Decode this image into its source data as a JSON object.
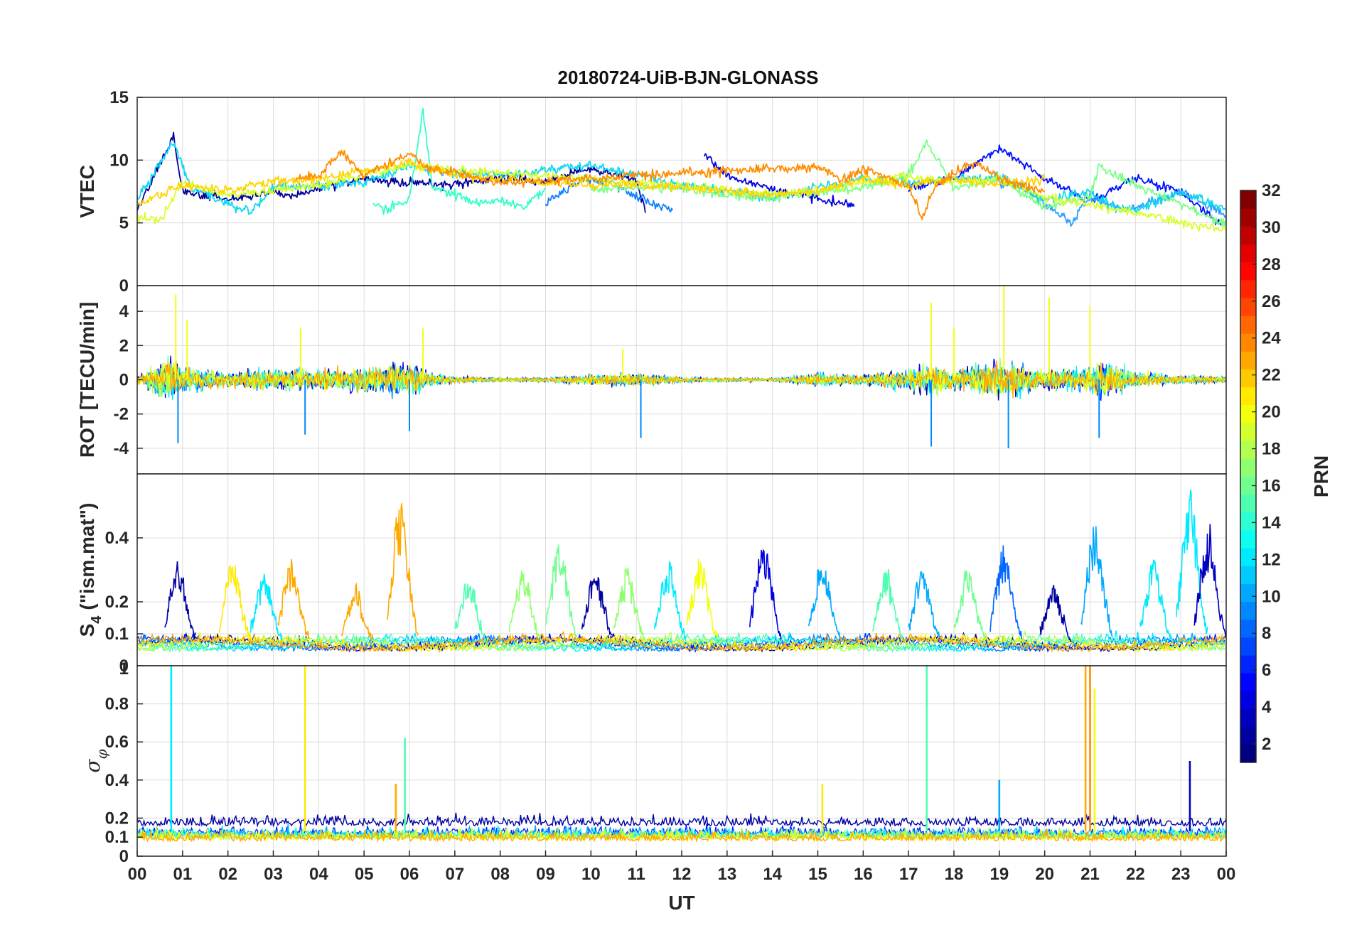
{
  "chart_data": {
    "type": "line",
    "title": "20180724-UiB-BJN-GLONASS",
    "xlabel": "UT",
    "xlim": [
      0,
      24
    ],
    "x_ticks": [
      "00",
      "01",
      "02",
      "03",
      "04",
      "05",
      "06",
      "07",
      "08",
      "09",
      "10",
      "11",
      "12",
      "13",
      "14",
      "15",
      "16",
      "17",
      "18",
      "19",
      "20",
      "21",
      "22",
      "23",
      "00"
    ],
    "grid": true,
    "colorbar": {
      "label": "PRN",
      "range": [
        1,
        32
      ],
      "ticks": [
        "2",
        "4",
        "6",
        "8",
        "10",
        "12",
        "14",
        "16",
        "18",
        "20",
        "22",
        "24",
        "26",
        "28",
        "30",
        "32"
      ],
      "colormap": "jet",
      "placement": "right"
    },
    "panels": [
      {
        "ylabel": "VTEC",
        "ylim": [
          0,
          15
        ],
        "y_ticks": [
          "0",
          "5",
          "10",
          "15"
        ],
        "series": [
          {
            "prn": 2,
            "color": "#00009f",
            "x": [
              0.0,
              0.8,
              1.0,
              2.0,
              3.0,
              3.5,
              4.0,
              5.0,
              6.0,
              7.0,
              8.0,
              9.0,
              10.0,
              11.0,
              11.2
            ],
            "y": [
              6.0,
              12.0,
              7.5,
              6.8,
              7.5,
              7.0,
              7.8,
              8.5,
              8.2,
              8.0,
              8.6,
              8.2,
              9.4,
              8.4,
              5.8
            ]
          },
          {
            "prn": 4,
            "color": "#0000e0",
            "x": [
              12.5,
              13.0,
              14.0,
              15.0,
              15.8
            ],
            "y": [
              10.3,
              8.8,
              7.6,
              7.0,
              6.3
            ]
          },
          {
            "prn": 3,
            "color": "#0010ff",
            "x": [
              17.0,
              18.0,
              19.0,
              20.0,
              21.0,
              22.0,
              23.0,
              23.9
            ],
            "y": [
              7.8,
              8.5,
              11.0,
              8.5,
              6.8,
              8.5,
              7.5,
              4.8
            ]
          },
          {
            "prn": 9,
            "color": "#1080ff",
            "x": [
              9.0,
              9.8,
              10.5,
              11.0,
              11.8
            ],
            "y": [
              6.5,
              8.5,
              8.2,
              7.0,
              6.0
            ]
          },
          {
            "prn": 10,
            "color": "#2a9fff",
            "x": [
              19.0,
              19.5,
              20.0,
              20.6,
              21.0,
              21.8,
              22.5,
              23.0,
              24.0
            ],
            "y": [
              8.0,
              8.0,
              6.5,
              5.0,
              7.0,
              6.0,
              6.8,
              7.5,
              5.6
            ]
          },
          {
            "prn": 12,
            "color": "#10d8f0",
            "x": [
              0.0,
              0.8,
              1.2,
              2.0,
              2.5,
              3.0,
              4.0,
              5.0,
              6.0,
              7.0,
              8.0,
              9.0,
              10.0,
              11.0,
              12.0,
              13.0,
              14.0,
              15.0,
              16.0,
              17.0,
              18.0,
              19.0,
              20.0,
              21.0,
              21.5,
              22.0,
              23.0,
              24.0
            ],
            "y": [
              6.8,
              11.5,
              7.8,
              6.5,
              5.8,
              7.8,
              8.0,
              8.2,
              9.5,
              9.0,
              8.8,
              9.2,
              9.6,
              8.8,
              8.0,
              7.5,
              7.0,
              7.8,
              8.5,
              8.2,
              8.5,
              8.6,
              6.8,
              7.5,
              6.2,
              6.0,
              7.5,
              6.0
            ]
          },
          {
            "prn": 15,
            "color": "#30ffc8",
            "x": [
              5.2,
              5.5,
              6.0,
              6.3,
              6.5,
              7.0,
              7.5,
              8.0,
              8.5,
              9.0
            ],
            "y": [
              6.5,
              6.0,
              7.0,
              14.0,
              8.0,
              7.2,
              6.5,
              6.8,
              6.2,
              7.8
            ]
          },
          {
            "prn": 17,
            "color": "#7aff85",
            "x": [
              10.0,
              11.0,
              12.0,
              13.0,
              14.0,
              15.0,
              16.0,
              17.0,
              17.4,
              18.0,
              19.0,
              20.0,
              21.0,
              21.2,
              22.0,
              23.0,
              24.0
            ],
            "y": [
              7.6,
              7.8,
              7.8,
              7.2,
              7.0,
              7.5,
              7.8,
              8.8,
              11.5,
              7.8,
              8.5,
              6.2,
              7.0,
              9.5,
              8.0,
              6.5,
              4.8
            ]
          },
          {
            "prn": 19,
            "color": "#d8ff28",
            "x": [
              0.0,
              0.5,
              1.0,
              2.0,
              3.0,
              4.0,
              5.0,
              6.0,
              7.0,
              8.0,
              9.0,
              10.0,
              11.0,
              12.0,
              13.0,
              14.0,
              15.0,
              16.0,
              17.0,
              18.0,
              19.0,
              20.0,
              21.0,
              22.0,
              23.0,
              24.0
            ],
            "y": [
              5.5,
              5.2,
              8.2,
              7.2,
              7.5,
              8.0,
              8.8,
              9.6,
              9.2,
              9.0,
              8.8,
              8.5,
              8.2,
              8.0,
              7.5,
              7.3,
              7.6,
              8.2,
              8.8,
              8.2,
              8.5,
              7.0,
              6.5,
              5.8,
              5.0,
              4.5
            ]
          },
          {
            "prn": 21,
            "color": "#ffd400",
            "x": [
              0.0,
              1.0,
              2.0,
              3.0,
              4.0,
              5.0,
              6.0,
              7.0,
              8.0,
              9.0,
              10.0,
              11.0,
              12.0,
              13.0,
              14.0,
              15.0,
              16.0,
              17.0,
              18.0,
              19.0,
              20.0
            ],
            "y": [
              6.5,
              8.0,
              7.5,
              8.3,
              8.5,
              9.2,
              9.8,
              8.8,
              8.5,
              8.2,
              8.0,
              8.0,
              7.8,
              7.6,
              7.2,
              7.5,
              8.5,
              8.0,
              8.5,
              8.0,
              8.5
            ]
          },
          {
            "prn": 23,
            "color": "#ff8c00",
            "x": [
              3.5,
              4.0,
              4.5,
              5.0,
              5.5,
              6.0,
              6.5,
              7.0,
              7.5,
              8.0,
              15.0,
              15.5,
              16.0,
              17.0,
              17.3,
              17.6,
              18.0,
              18.5,
              19.0,
              19.5,
              20.0
            ],
            "y": [
              8.5,
              8.8,
              10.6,
              8.8,
              9.6,
              10.5,
              9.2,
              9.0,
              8.5,
              8.2,
              9.5,
              8.5,
              9.2,
              8.0,
              5.5,
              8.0,
              9.0,
              9.8,
              8.5,
              8.0,
              7.5
            ]
          }
        ]
      },
      {
        "ylabel": "ROT [TECU/min]",
        "ylim": [
          -5.5,
          5.5
        ],
        "y_ticks": [
          "-4",
          "-2",
          "0",
          "2",
          "4"
        ],
        "noise_profile": {
          "hours": [
            0,
            0.8,
            1,
            2,
            3,
            4,
            5,
            6,
            6.5,
            7,
            8,
            9,
            10,
            11,
            12,
            13,
            14,
            15,
            16,
            17,
            17.5,
            18,
            19,
            20,
            21,
            21.2,
            22,
            23,
            24
          ],
          "amplitude": [
            0.3,
            2.5,
            1.2,
            0.7,
            1.0,
            1.0,
            1.2,
            1.6,
            0.6,
            0.3,
            0.2,
            0.2,
            0.5,
            0.6,
            0.25,
            0.2,
            0.15,
            0.6,
            0.5,
            1.0,
            1.5,
            1.0,
            1.8,
            0.9,
            1.2,
            2.0,
            0.7,
            0.4,
            0.3
          ]
        },
        "spikes": [
          [
            0.85,
            5.0
          ],
          [
            0.9,
            -3.7
          ],
          [
            1.1,
            3.5
          ],
          [
            3.6,
            3.0
          ],
          [
            3.7,
            -3.2
          ],
          [
            6.3,
            3.0
          ],
          [
            6.0,
            -3.0
          ],
          [
            11.1,
            -3.4
          ],
          [
            17.5,
            4.5
          ],
          [
            17.5,
            -3.9
          ],
          [
            19.1,
            5.5
          ],
          [
            19.2,
            -4.0
          ],
          [
            20.1,
            4.8
          ],
          [
            21.0,
            4.3
          ],
          [
            21.2,
            -3.4
          ],
          [
            18.0,
            3.0
          ],
          [
            10.7,
            1.8
          ]
        ]
      },
      {
        "ylabel": "S4 (\"ism.mat\")",
        "ylabel_main": "S",
        "ylabel_sub": "4",
        "ylabel_rest": "(\"ism.mat\")",
        "ylim": [
          0,
          0.6
        ],
        "y_ticks": [
          "0",
          "0.1",
          "0.2",
          "0.4"
        ],
        "baseline": 0.06,
        "bursts": [
          [
            0.9,
            0.33,
            2
          ],
          [
            2.1,
            0.33,
            21
          ],
          [
            2.8,
            0.3,
            12
          ],
          [
            3.4,
            0.33,
            23
          ],
          [
            4.8,
            0.25,
            23
          ],
          [
            5.8,
            0.52,
            23
          ],
          [
            7.3,
            0.28,
            15
          ],
          [
            8.5,
            0.3,
            17
          ],
          [
            9.3,
            0.4,
            16
          ],
          [
            10.1,
            0.3,
            2
          ],
          [
            10.8,
            0.3,
            17
          ],
          [
            11.7,
            0.33,
            12
          ],
          [
            12.4,
            0.33,
            20
          ],
          [
            13.8,
            0.4,
            4
          ],
          [
            15.1,
            0.33,
            10
          ],
          [
            16.5,
            0.3,
            15
          ],
          [
            17.3,
            0.3,
            10
          ],
          [
            18.3,
            0.3,
            16
          ],
          [
            19.1,
            0.37,
            8
          ],
          [
            20.2,
            0.25,
            2
          ],
          [
            21.1,
            0.45,
            10
          ],
          [
            22.4,
            0.33,
            12
          ],
          [
            23.2,
            0.55,
            12
          ],
          [
            23.6,
            0.44,
            3
          ]
        ]
      },
      {
        "ylabel": "σφ",
        "ylabel_main": "σ",
        "ylabel_sub": "φ",
        "ylim": [
          0,
          1.0
        ],
        "y_ticks": [
          "0",
          "0.1",
          "0.2",
          "0.4",
          "0.6",
          "0.8"
        ],
        "top_tick_label": "1",
        "baseline": 0.13,
        "spikes": [
          [
            0.75,
            1.0,
            12
          ],
          [
            3.7,
            1.0,
            21
          ],
          [
            5.9,
            0.62,
            15
          ],
          [
            5.7,
            0.38,
            23
          ],
          [
            17.4,
            1.0,
            15
          ],
          [
            20.9,
            1.0,
            23
          ],
          [
            21.0,
            1.0,
            24
          ],
          [
            21.1,
            0.88,
            20
          ],
          [
            19.0,
            0.4,
            10
          ],
          [
            15.1,
            0.38,
            21
          ],
          [
            23.2,
            0.5,
            3
          ]
        ]
      }
    ]
  }
}
